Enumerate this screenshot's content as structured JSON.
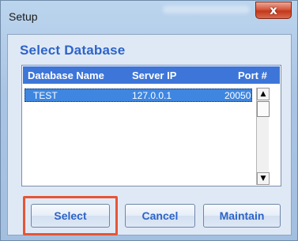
{
  "window": {
    "title": "Setup",
    "close_glyph": "x"
  },
  "heading": "Select Database",
  "list": {
    "columns": [
      "Database Name",
      "Server IP",
      "Port #"
    ],
    "rows": [
      {
        "name": "TEST",
        "ip": "127.0.0.1",
        "port": "20050",
        "selected": true
      }
    ],
    "scroll_up_glyph": "▲",
    "scroll_down_glyph": "▼"
  },
  "buttons": {
    "select": "Select",
    "cancel": "Cancel",
    "maintain": "Maintain"
  },
  "colors": {
    "accent_text": "#2d64c8",
    "header_bg": "#3d76d8",
    "selection_bg": "#3e86e0",
    "highlight_border": "#e65536"
  },
  "icons": {
    "close": "close-icon",
    "scroll_up": "chevron-up-icon",
    "scroll_down": "chevron-down-icon"
  }
}
